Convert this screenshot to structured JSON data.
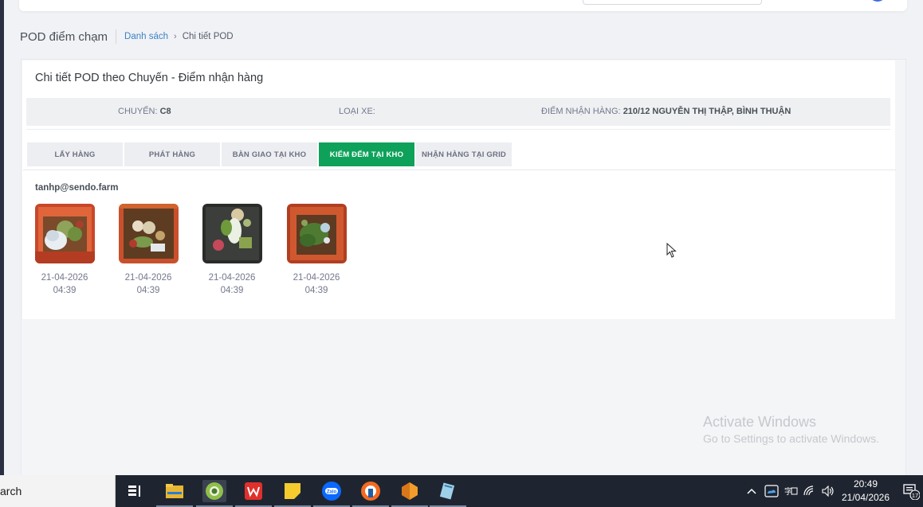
{
  "header": {
    "page_title": "POD điểm chạm",
    "breadcrumb_link": "Danh sách",
    "breadcrumb_sep": "›",
    "breadcrumb_current": "Chi tiết POD"
  },
  "card": {
    "title": "Chi tiết POD theo Chuyến - Điểm nhận hàng",
    "info": {
      "trip_label": "CHUYẾN:",
      "trip_value": "C8",
      "vehicle_label": "LOẠI XE:",
      "vehicle_value": "",
      "pickup_label": "ĐIỂM NHẬN HÀNG:",
      "pickup_value": "210/12 NGUYỄN THỊ THẬP, BÌNH THUẬN"
    },
    "tabs": [
      {
        "label": "LẤY HÀNG",
        "active": false
      },
      {
        "label": "PHÁT HÀNG",
        "active": false
      },
      {
        "label": "BÀN GIAO TẠI KHO",
        "active": false
      },
      {
        "label": "KIỂM ĐẾM TẠI KHO",
        "active": true
      },
      {
        "label": "NHẬN HÀNG TẠI GRID",
        "active": false
      }
    ],
    "uploader": "tanhp@sendo.farm",
    "photos": [
      {
        "date": "21-04-2026",
        "time": "04:39"
      },
      {
        "date": "21-04-2026",
        "time": "04:39"
      },
      {
        "date": "21-04-2026",
        "time": "04:39"
      },
      {
        "date": "21-04-2026",
        "time": "04:39"
      }
    ]
  },
  "watermark": {
    "line1": "Activate Windows",
    "line2": "Go to Settings to activate Windows."
  },
  "taskbar": {
    "search_text": "arch",
    "time": "20:49",
    "date": "21/04/2026",
    "notification_count": "17",
    "apps": [
      "task-view-icon",
      "file-explorer-icon",
      "chrome-icon",
      "wps-office-icon",
      "sticky-notes-icon",
      "zalo-icon",
      "ultraviewer-icon",
      "sublime-icon",
      "notepad-icon"
    ]
  },
  "colors": {
    "active_tab": "#0ea15a",
    "link": "#3b82c4",
    "taskbar": "#1f2530"
  }
}
